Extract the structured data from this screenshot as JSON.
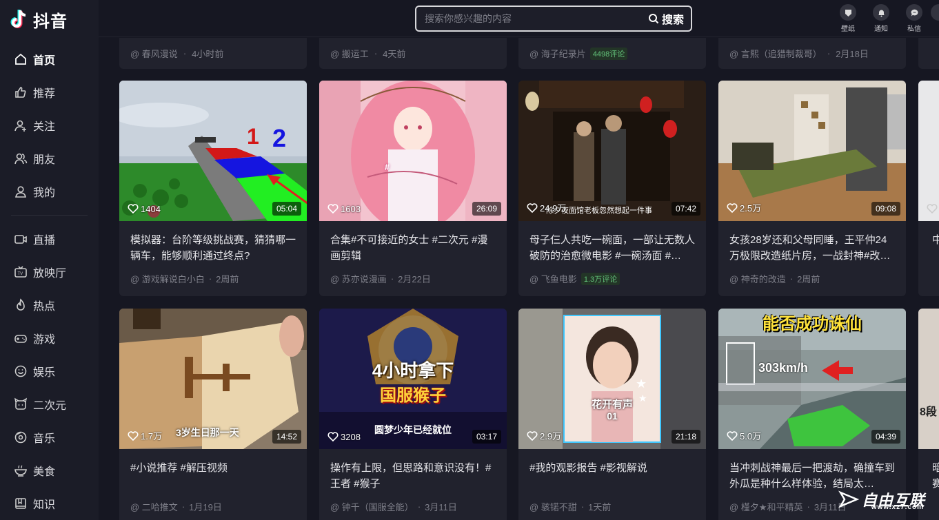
{
  "app": {
    "name": "抖音"
  },
  "nav": {
    "items": [
      {
        "label": "首页"
      },
      {
        "label": "推荐"
      },
      {
        "label": "关注"
      },
      {
        "label": "朋友"
      },
      {
        "label": "我的"
      },
      {
        "label": "直播"
      },
      {
        "label": "放映厅"
      },
      {
        "label": "热点"
      },
      {
        "label": "游戏"
      },
      {
        "label": "娱乐"
      },
      {
        "label": "二次元"
      },
      {
        "label": "音乐"
      },
      {
        "label": "美食"
      },
      {
        "label": "知识"
      }
    ]
  },
  "search": {
    "placeholder": "搜索你感兴趣的内容",
    "button": "搜索"
  },
  "top_actions": [
    {
      "label": "壁纸"
    },
    {
      "label": "通知"
    },
    {
      "label": "私信"
    }
  ],
  "row0": [
    {
      "author": "@ 春风漫说",
      "time": "4小时前"
    },
    {
      "author": "@ 搬运工",
      "time": "4天前"
    },
    {
      "author": "@ 海子纪录片",
      "tag": "4498评论"
    },
    {
      "author": "@ 言熙（追猎制裁哥）",
      "time": "2月18日"
    }
  ],
  "cards": [
    {
      "likes": "1404",
      "duration": "05:04",
      "title": "模拟器：台阶等级挑战赛，猜猜哪一辆车，能够顺利通过终点?",
      "author": "@ 游戏解说白小白",
      "time": "2周前"
    },
    {
      "likes": "1603",
      "duration": "26:09",
      "title": "合集#不可接近的女士 #二次元 #漫画剪辑",
      "author": "@ 苏亦说漫画",
      "time": "2月22日"
    },
    {
      "likes": "24.9万",
      "duration": "07:42",
      "title": "母子仨人共吃一碗面，一部让无数人破防的治愈微电影 #一碗汤面 #…",
      "author": "@ 飞鱼电影",
      "tag": "1.3万评论",
      "overlay": "除夕夜面馆老板忽然想起一件事"
    },
    {
      "likes": "2.5万",
      "duration": "09:08",
      "title": "女孩28岁还和父母同睡，王平仲24万极限改造纸片房，一战封神#改…",
      "author": "@ 神奇的改造",
      "time": "2周前"
    },
    {
      "likes": "1.7万",
      "duration": "14:52",
      "title": "#小说推荐 #解压视频",
      "author": "@ 二哈推文",
      "time": "1月19日",
      "overlay": "3岁生日那一天"
    },
    {
      "likes": "3208",
      "duration": "03:17",
      "title": "操作有上限，但思路和意识没有！#王者 #猴子",
      "author": "@ 钟千（国服全能）",
      "time": "3月11日",
      "overlay1": "4小时拿下",
      "overlay2": "国服猴子",
      "overlay3": "圆梦少年已经就位"
    },
    {
      "likes": "2.9万",
      "duration": "21:18",
      "title": "#我的观影报告 #影视解说",
      "author": "@ 骇锘不甜",
      "time": "1天前",
      "overlay": "花开有声",
      "overlay_sub": "01"
    },
    {
      "likes": "5.0万",
      "duration": "04:39",
      "title": "当冲刺战神最后一把渡劫，确撞车到外瓜是种什么样体验，结局太…",
      "author": "@ 槿夕★和平精英",
      "time": "3月11日",
      "overlay": "能否成功诛仙",
      "overlay_speed": "303km/h"
    }
  ],
  "edge_texts": [
    "中",
    "暗",
    "赛",
    "8段"
  ],
  "watermark": {
    "text": "自由互联",
    "small": "www.xz7.com"
  }
}
